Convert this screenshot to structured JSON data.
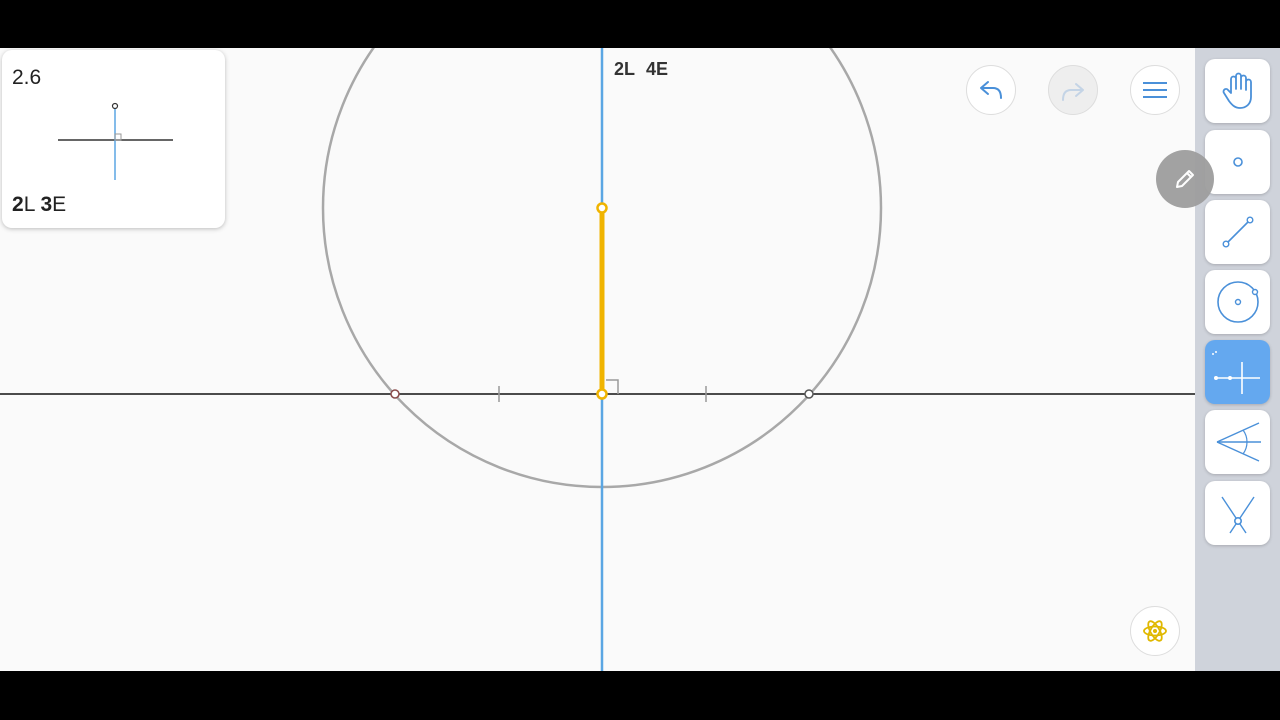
{
  "level": {
    "number": "2.6",
    "goal_lines": "2",
    "goal_lines_unit": "L",
    "goal_elements": "3",
    "goal_elements_unit": "E"
  },
  "score": {
    "lines": "2L",
    "elements": "4E"
  },
  "icons": {
    "undo": "undo-arrow-icon",
    "redo": "redo-arrow-icon",
    "menu": "hamburger-menu-icon",
    "edit": "pencil-icon",
    "hint": "atom-hint-icon"
  },
  "toolbar": {
    "tools": [
      {
        "name": "move",
        "icon": "hand-icon",
        "active": false
      },
      {
        "name": "point",
        "icon": "point-icon",
        "active": false
      },
      {
        "name": "line",
        "icon": "line-icon",
        "active": false
      },
      {
        "name": "circle",
        "icon": "circle-icon",
        "active": false
      },
      {
        "name": "perpendicular",
        "icon": "perpendicular-icon",
        "active": true
      },
      {
        "name": "angle-bisector",
        "icon": "angle-bisector-icon",
        "active": false
      },
      {
        "name": "intersection",
        "icon": "intersection-icon",
        "active": false
      }
    ]
  },
  "colors": {
    "accent_blue": "#64a8ef",
    "highlight_orange": "#f0b400",
    "circle_gray": "#a8a8a8",
    "toolbar_bg": "#cfd3db"
  }
}
